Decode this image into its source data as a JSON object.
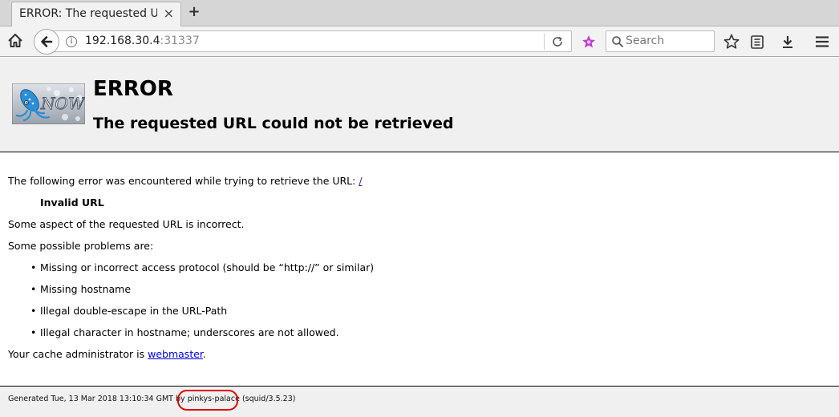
{
  "browser": {
    "tab_title": "ERROR: The requested U…",
    "tab_close": "×",
    "new_tab": "+",
    "url_host": "192.168.30.4",
    "url_port": ":31337",
    "search_placeholder": "Search",
    "info_glyph": "i"
  },
  "page": {
    "heading": "ERROR",
    "subheading": "The requested URL could not be retrieved",
    "intro": "The following error was encountered while trying to retrieve the URL: ",
    "requested_url": "/",
    "error_code": "Invalid URL",
    "aspect": "Some aspect of the requested URL is incorrect.",
    "problems_intro": "Some possible problems are:",
    "problems": [
      "Missing or incorrect access protocol (should be “http://” or similar)",
      "Missing hostname",
      "Illegal double-escape in the URL-Path",
      "Illegal character in hostname; underscores are not allowed."
    ],
    "admin_prefix": "Your cache administrator is ",
    "admin_link": "webmaster",
    "admin_suffix": ".",
    "footer_prefix": "Generated Tue, 13 Mar 2018 13:10:34 GMT by ",
    "footer_host": "pinkys-palace",
    "footer_suffix": " (squid/3.5.23)"
  },
  "logo": {
    "text": "NOW",
    "accent": "#2a8fd6"
  },
  "colors": {
    "link": "#0000ee",
    "visited_link": "#551a8b",
    "highlight": "#e00000",
    "extension": "#c040d0"
  }
}
